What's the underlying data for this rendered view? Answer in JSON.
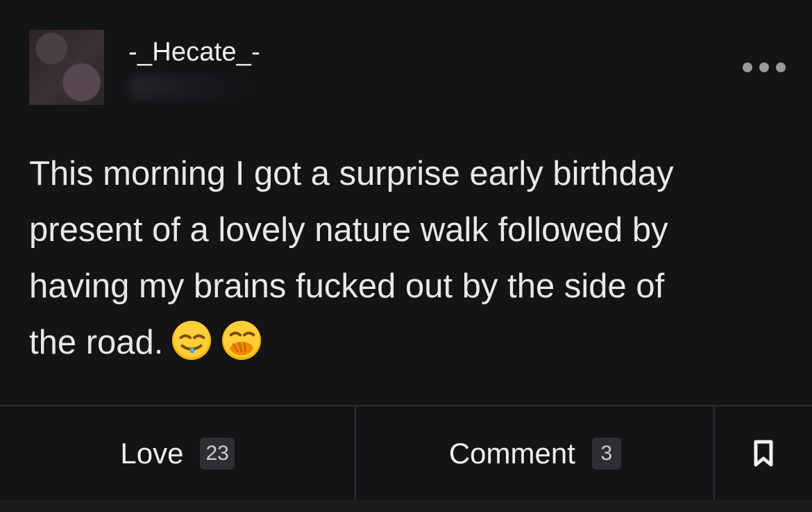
{
  "post": {
    "username": "-_Hecate_-",
    "body_line1": "This morning I got a surprise early birthday",
    "body_line2": "present of a lovely nature walk followed by",
    "body_line3": "having my brains fucked out by the side of",
    "body_line4": "the road.",
    "emojis": [
      "drooling-face-emoji",
      "face-with-hand-over-mouth-emoji"
    ]
  },
  "actions": {
    "love_label": "Love",
    "love_count": "23",
    "comment_label": "Comment",
    "comment_count": "3",
    "bookmark_icon": "bookmark-icon",
    "more_icon": "more-options-icon"
  },
  "colors": {
    "background": "#141316",
    "text": "#e9e9e9",
    "badge_bg": "#2f2e32",
    "divider": "#2e2d31"
  }
}
